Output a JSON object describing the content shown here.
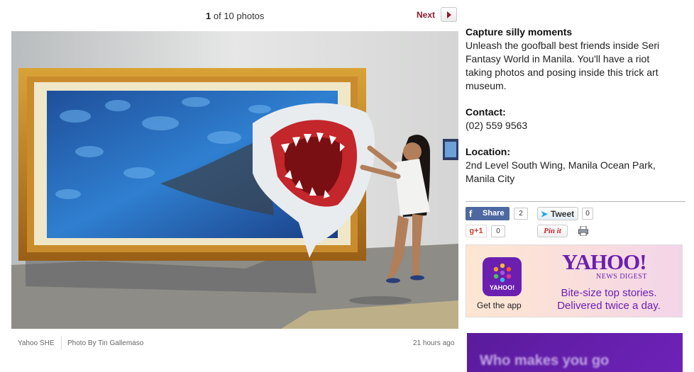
{
  "pager": {
    "current": "1",
    "of_text": "of 10 photos"
  },
  "next_label": "Next",
  "article": {
    "title": "Capture silly moments",
    "body": "Unleash the goofball best friends inside Seri Fantasy World in Manila. You'll have a riot taking photos and posing inside this trick art museum.",
    "contact_heading": "Contact:",
    "contact_value": "(02) 559 9563",
    "location_heading": "Location:",
    "location_value": "2nd Level South Wing, Manila Ocean Park, Manila City"
  },
  "photo_meta": {
    "source": "Yahoo SHE",
    "credit": "Photo By Tin Gallemaso",
    "time": "21 hours ago"
  },
  "social": {
    "fb_label": "Share",
    "fb_count": "2",
    "tw_label": "Tweet",
    "tw_count": "0",
    "gplus_label": "g+1",
    "gplus_count": "0",
    "pin_label": "Pin it"
  },
  "ad": {
    "brand": "YAHOO!",
    "product": "NEWS DIGEST",
    "icon_text": "YAHOO!",
    "cta": "Get the app",
    "tagline_1": "Bite-size top stories.",
    "tagline_2": "Delivered twice a day."
  },
  "ad2_text": "Who makes you go",
  "colors": {
    "accent": "#8b1a2b",
    "facebook": "#4e69a2",
    "yahoo_purple": "#6b1fb1"
  }
}
